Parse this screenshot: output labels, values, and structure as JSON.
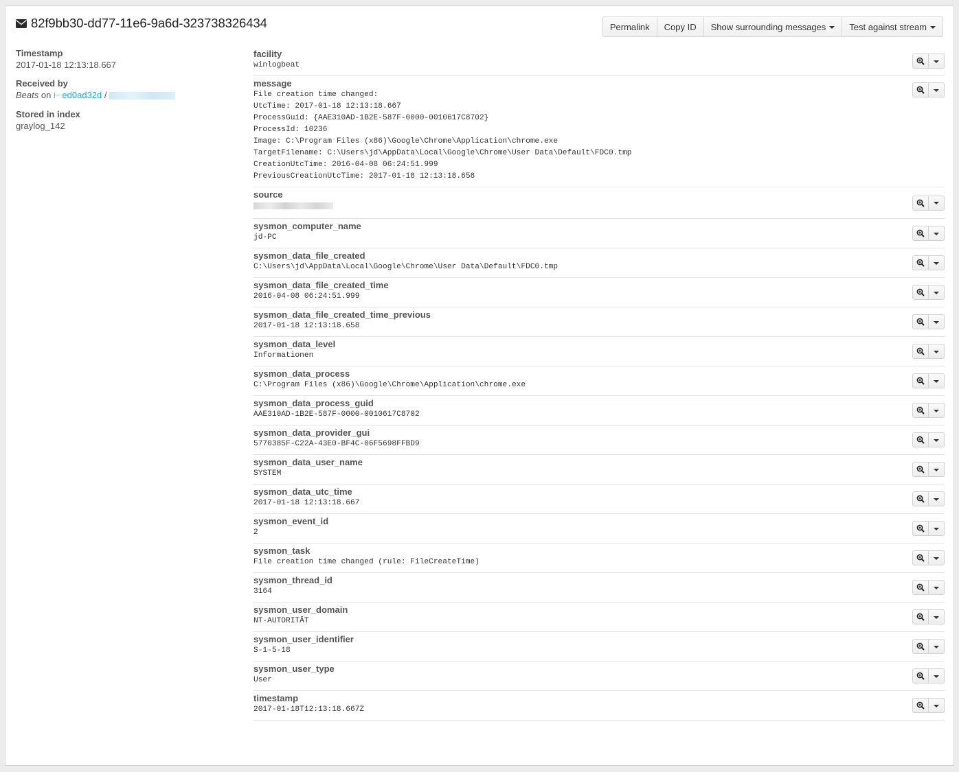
{
  "message_id": "82f9bb30-dd77-11e6-9a6d-323738326434",
  "toolbar": {
    "permalink_label": "Permalink",
    "copy_id_label": "Copy ID",
    "surrounding_label": "Show surrounding messages",
    "test_stream_label": "Test against stream"
  },
  "meta": {
    "timestamp_label": "Timestamp",
    "timestamp_value": "2017-01-18 12:13:18.667",
    "received_by_label": "Received by",
    "received_by_input": "Beats",
    "received_by_on": "on",
    "received_by_node": "ed0ad32d",
    "received_by_separator": "/",
    "stored_label": "Stored in index",
    "stored_value": "graylog_142"
  },
  "fields": [
    {
      "name": "facility",
      "value": "winlogbeat"
    },
    {
      "name": "message",
      "value": "File creation time changed:\nUtcTime: 2017-01-18 12:13:18.667\nProcessGuid: {AAE310AD-1B2E-587F-0000-0010617C8702}\nProcessId: 10236\nImage: C:\\Program Files (x86)\\Google\\Chrome\\Application\\chrome.exe\nTargetFilename: C:\\Users\\jd\\AppData\\Local\\Google\\Chrome\\User Data\\Default\\FDC0.tmp\nCreationUtcTime: 2016-04-08 06:24:51.999\nPreviousCreationUtcTime: 2017-01-18 12:13:18.658"
    },
    {
      "name": "source",
      "value": ""
    },
    {
      "name": "sysmon_computer_name",
      "value": "jd-PC"
    },
    {
      "name": "sysmon_data_file_created",
      "value": "C:\\Users\\jd\\AppData\\Local\\Google\\Chrome\\User Data\\Default\\FDC0.tmp"
    },
    {
      "name": "sysmon_data_file_created_time",
      "value": "2016-04-08 06:24:51.999"
    },
    {
      "name": "sysmon_data_file_created_time_previous",
      "value": "2017-01-18 12:13:18.658"
    },
    {
      "name": "sysmon_data_level",
      "value": "Informationen"
    },
    {
      "name": "sysmon_data_process",
      "value": "C:\\Program Files (x86)\\Google\\Chrome\\Application\\chrome.exe"
    },
    {
      "name": "sysmon_data_process_guid",
      "value": "AAE310AD-1B2E-587F-0000-0010617C8702"
    },
    {
      "name": "sysmon_data_provider_gui",
      "value": "5770385F-C22A-43E0-BF4C-06F5698FFBD9"
    },
    {
      "name": "sysmon_data_user_name",
      "value": "SYSTEM"
    },
    {
      "name": "sysmon_data_utc_time",
      "value": "2017-01-18 12:13:18.667"
    },
    {
      "name": "sysmon_event_id",
      "value": "2"
    },
    {
      "name": "sysmon_task",
      "value": "File creation time changed (rule: FileCreateTime)"
    },
    {
      "name": "sysmon_thread_id",
      "value": "3164"
    },
    {
      "name": "sysmon_user_domain",
      "value": "NT-AUTORITÄT"
    },
    {
      "name": "sysmon_user_identifier",
      "value": "S-1-5-18"
    },
    {
      "name": "sysmon_user_type",
      "value": "User"
    },
    {
      "name": "timestamp",
      "value": "2017-01-18T12:13:18.667Z"
    }
  ],
  "colors": {
    "link": "#16ace3",
    "background": "#ececec",
    "panel": "#ffffff"
  },
  "icons": {
    "title": "envelope-icon",
    "field_action": "search-plus-icon",
    "field_menu": "caret-down-icon",
    "node": "node-icon"
  }
}
